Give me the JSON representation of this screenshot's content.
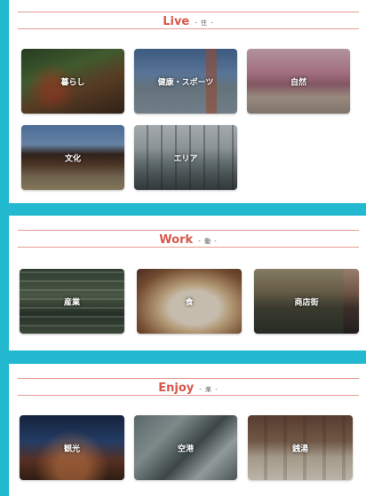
{
  "sections": {
    "live": {
      "title": "Live",
      "sub": "- 住 -",
      "tiles": [
        "暮らし",
        "健康・スポーツ",
        "自然",
        "文化",
        "エリア"
      ]
    },
    "work": {
      "title": "Work",
      "sub": "- 働 -",
      "tiles": [
        "産業",
        "食",
        "商店街"
      ]
    },
    "enjoy": {
      "title": "Enjoy",
      "sub": "- 楽 -",
      "tiles": [
        "観光",
        "空港",
        "銭湯"
      ]
    }
  },
  "colors": {
    "background": "#22b8d0",
    "accent": "#d9574a",
    "rule": "#e79a90"
  }
}
